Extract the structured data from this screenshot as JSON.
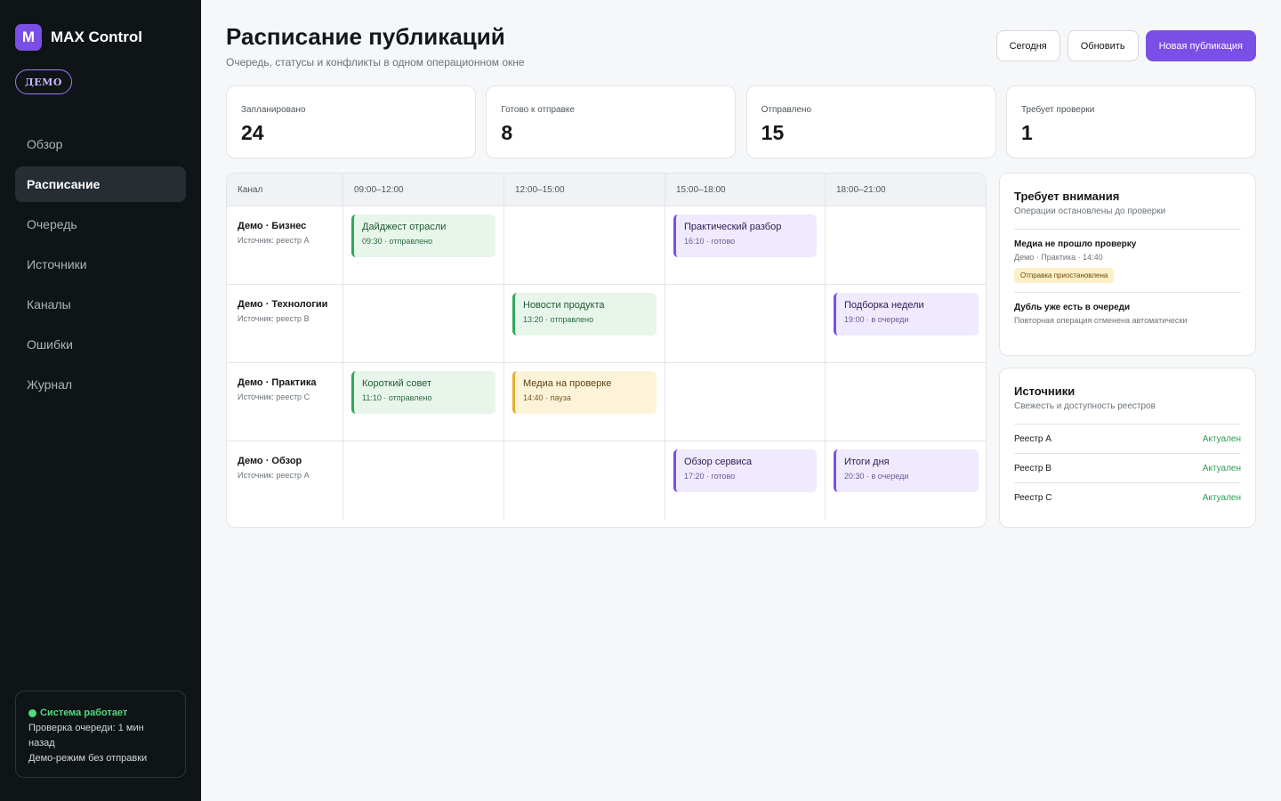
{
  "app": {
    "logo_letter": "M",
    "name": "MAX Control",
    "badge": "ДЕМО"
  },
  "nav": [
    {
      "label": "Обзор",
      "active": false
    },
    {
      "label": "Расписание",
      "active": true
    },
    {
      "label": "Очередь",
      "active": false
    },
    {
      "label": "Источники",
      "active": false
    },
    {
      "label": "Каналы",
      "active": false
    },
    {
      "label": "Ошибки",
      "active": false
    },
    {
      "label": "Журнал",
      "active": false
    }
  ],
  "system": {
    "status": "Система работает",
    "queue_check": "Проверка очереди: 1 мин назад",
    "mode": "Демо-режим без отправки"
  },
  "header": {
    "title": "Расписание публикаций",
    "subtitle": "Очередь, статусы и конфликты в одном операционном окне",
    "today_label": "Сегодня",
    "refresh_label": "Обновить",
    "new_label": "Новая публикация"
  },
  "stats": [
    {
      "label": "Запланировано",
      "value": "24"
    },
    {
      "label": "Готово к отправке",
      "value": "8"
    },
    {
      "label": "Отправлено",
      "value": "15"
    },
    {
      "label": "Требует проверки",
      "value": "1"
    }
  ],
  "schedule": {
    "columns": [
      "Канал",
      "09:00–12:00",
      "12:00–15:00",
      "15:00–18:00",
      "18:00–21:00"
    ],
    "rows": [
      {
        "channel": "Демо · Бизнес",
        "source": "Источник: реестр A",
        "slots": [
          {
            "title": "Дайджест отрасли",
            "meta": "09:30 · отправлено",
            "kind": "green"
          },
          null,
          {
            "title": "Практический разбор",
            "meta": "16:10 · готово",
            "kind": "purple"
          },
          null
        ]
      },
      {
        "channel": "Демо · Технологии",
        "source": "Источник: реестр B",
        "slots": [
          null,
          {
            "title": "Новости продукта",
            "meta": "13:20 · отправлено",
            "kind": "green"
          },
          null,
          {
            "title": "Подборка недели",
            "meta": "19:00 · в очереди",
            "kind": "purple"
          }
        ]
      },
      {
        "channel": "Демо · Практика",
        "source": "Источник: реестр C",
        "slots": [
          {
            "title": "Короткий совет",
            "meta": "11:10 · отправлено",
            "kind": "green"
          },
          {
            "title": "Медиа на проверке",
            "meta": "14:40 · пауза",
            "kind": "yellow"
          },
          null,
          null
        ]
      },
      {
        "channel": "Демо · Обзор",
        "source": "Источник: реестр A",
        "slots": [
          null,
          null,
          {
            "title": "Обзор сервиса",
            "meta": "17:20 · готово",
            "kind": "purple"
          },
          {
            "title": "Итоги дня",
            "meta": "20:30 · в очереди",
            "kind": "purple"
          }
        ]
      }
    ]
  },
  "attention": {
    "title": "Требует внимания",
    "subtitle": "Операции остановлены до проверки",
    "items": [
      {
        "title": "Медиа не прошло проверку",
        "meta": "Демо · Практика · 14:40",
        "pill": "Отправка приостановлена"
      },
      {
        "title": "Дубль уже есть в очереди",
        "meta": "Повторная операция отменена автоматически",
        "pill": null
      }
    ]
  },
  "sources": {
    "title": "Источники",
    "subtitle": "Свежесть и доступность реестров",
    "items": [
      {
        "name": "Реестр A",
        "status": "Актуален"
      },
      {
        "name": "Реестр B",
        "status": "Актуален"
      },
      {
        "name": "Реестр C",
        "status": "Актуален"
      }
    ]
  },
  "colors": {
    "accent": "#7b4fe6",
    "sidebar": "#0f1417",
    "ok": "#23a04f",
    "warn": "#e6ac2c"
  }
}
